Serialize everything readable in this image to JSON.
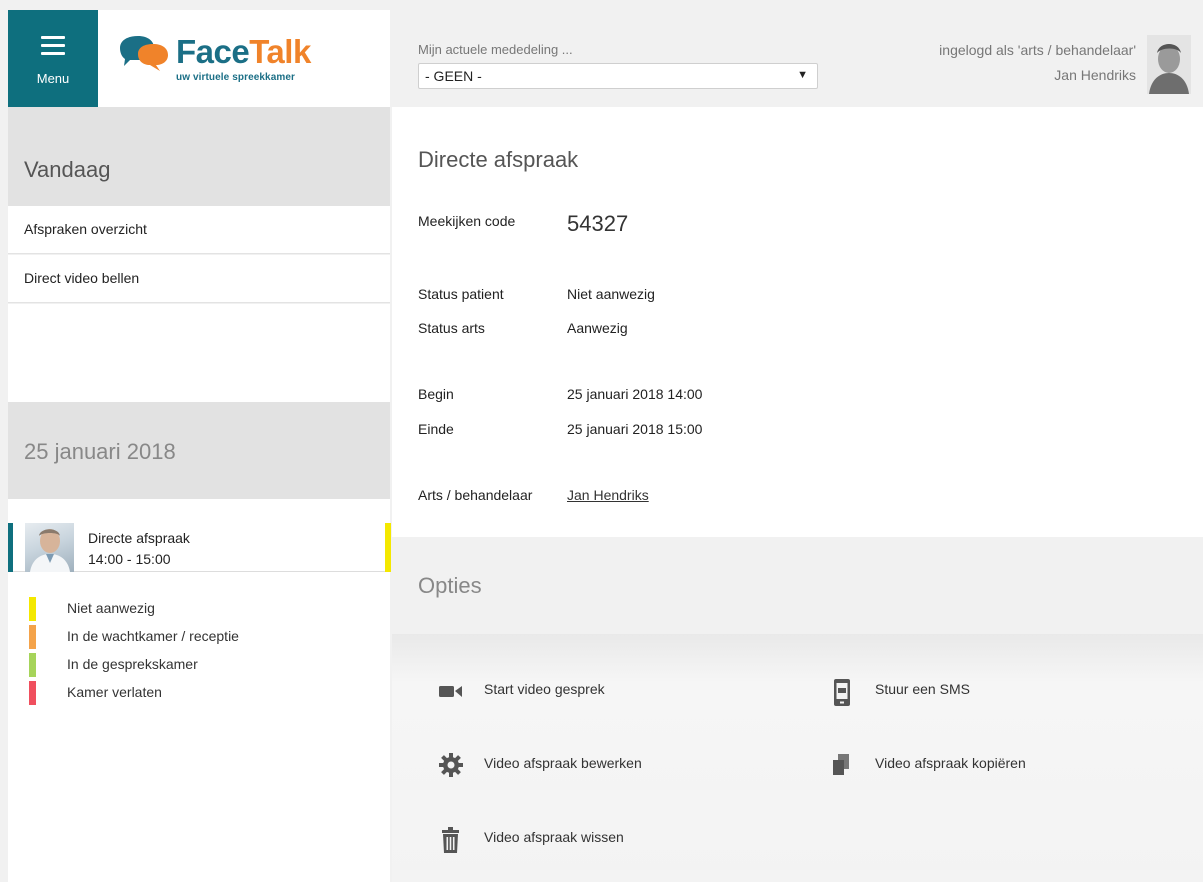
{
  "header": {
    "menu_label": "Menu",
    "brand": {
      "face": "Face",
      "talk": "Talk",
      "tagline": "uw virtuele spreekkamer"
    },
    "notice_label": "Mijn actuele mededeling ...",
    "notice_selected": "- GEEN -",
    "login_role": "ingelogd als 'arts / behandelaar'",
    "login_name": "Jan Hendriks"
  },
  "sidebar": {
    "today_title": "Vandaag",
    "links": [
      {
        "label": "Afspraken overzicht"
      },
      {
        "label": "Direct video bellen"
      }
    ],
    "date_title": "25 januari 2018",
    "appointment": {
      "title": "Directe afspraak",
      "time": "14:00 - 15:00"
    },
    "legend": [
      {
        "label": "Niet aanwezig",
        "color": "#f4e800"
      },
      {
        "label": "In de wachtkamer / receptie",
        "color": "#f4a34a"
      },
      {
        "label": "In de gesprekskamer",
        "color": "#a6d45a"
      },
      {
        "label": "Kamer verlaten",
        "color": "#f04f5e"
      }
    ]
  },
  "main": {
    "heading": "Directe afspraak",
    "code_label": "Meekijken code",
    "code_value": "54327",
    "status_patient_label": "Status patient",
    "status_patient_value": "Niet aanwezig",
    "status_arts_label": "Status arts",
    "status_arts_value": "Aanwezig",
    "begin_label": "Begin",
    "begin_value": "25 januari 2018 14:00",
    "end_label": "Einde",
    "end_value": "25 januari 2018 15:00",
    "doctor_label": "Arts / behandelaar",
    "doctor_value": "Jan Hendriks"
  },
  "options": {
    "heading": "Opties",
    "items": [
      {
        "label": "Start video gesprek",
        "icon": "video-camera-icon"
      },
      {
        "label": "Stuur een SMS",
        "icon": "phone-sms-icon"
      },
      {
        "label": "Video afspraak bewerken",
        "icon": "gear-icon"
      },
      {
        "label": "Video afspraak kopiëren",
        "icon": "copy-icon"
      },
      {
        "label": "Video afspraak wissen",
        "icon": "trash-icon"
      }
    ]
  },
  "colors": {
    "teal": "#0e6f7e",
    "brand_blue": "#1b6f86",
    "brand_orange": "#f0832a",
    "status_yellow": "#f4e800"
  }
}
